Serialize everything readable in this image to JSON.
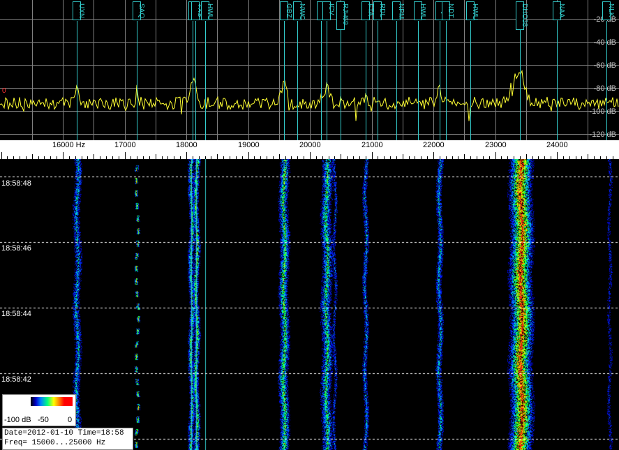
{
  "spectrum": {
    "station_labels": [
      {
        "label": "UXN",
        "freq": 16230
      },
      {
        "label": "SAQ",
        "freq": 17200
      },
      {
        "label": "RDL",
        "freq": 18100
      },
      {
        "label": "TXS",
        "freq": 18150
      },
      {
        "label": "HWU",
        "freq": 18300
      },
      {
        "label": "GBZ",
        "freq": 19580
      },
      {
        "label": "NWC",
        "freq": 19800
      },
      {
        "label": "RDL",
        "freq": 20180
      },
      {
        "label": "ICV",
        "freq": 20270
      },
      {
        "label": "RJH69",
        "freq": 20500
      },
      {
        "label": "FTA",
        "freq": 20900
      },
      {
        "label": "RDL",
        "freq": 21100
      },
      {
        "label": "NPM",
        "freq": 21400
      },
      {
        "label": "HWU",
        "freq": 21750
      },
      {
        "label": "GQD",
        "freq": 22100
      },
      {
        "label": "NDT",
        "freq": 22200
      },
      {
        "label": "HWU",
        "freq": 22600
      },
      {
        "label": "DHO38",
        "freq": 23400
      },
      {
        "label": "NAA",
        "freq": 24000
      },
      {
        "label": "NLK",
        "freq": 24800
      }
    ],
    "db_labels": [
      "-20 dB",
      "-40 dB",
      "-60 dB",
      "-80 dB",
      "-100 dB",
      "-120 dB"
    ],
    "reference_marker": "0"
  },
  "scale": {
    "labels": [
      "16000 Hz",
      "17000",
      "18000",
      "19000",
      "20000",
      "21000",
      "22000",
      "23000",
      "24000"
    ]
  },
  "waterfall": {
    "time_labels": [
      "18:58:48",
      "18:58:46",
      "18:58:44",
      "18:58:42"
    ]
  },
  "legend": {
    "min_label": "-100 dB",
    "mid_label": "-50",
    "max_label": "0"
  },
  "info": {
    "date_line": "Date=2012-01-10 Time=18:58",
    "freq_line": "Freq= 15000...25000 Hz"
  },
  "colors": {
    "trace": "#ffff33",
    "marker_line": "#33cccc",
    "grid": "#808080"
  }
}
